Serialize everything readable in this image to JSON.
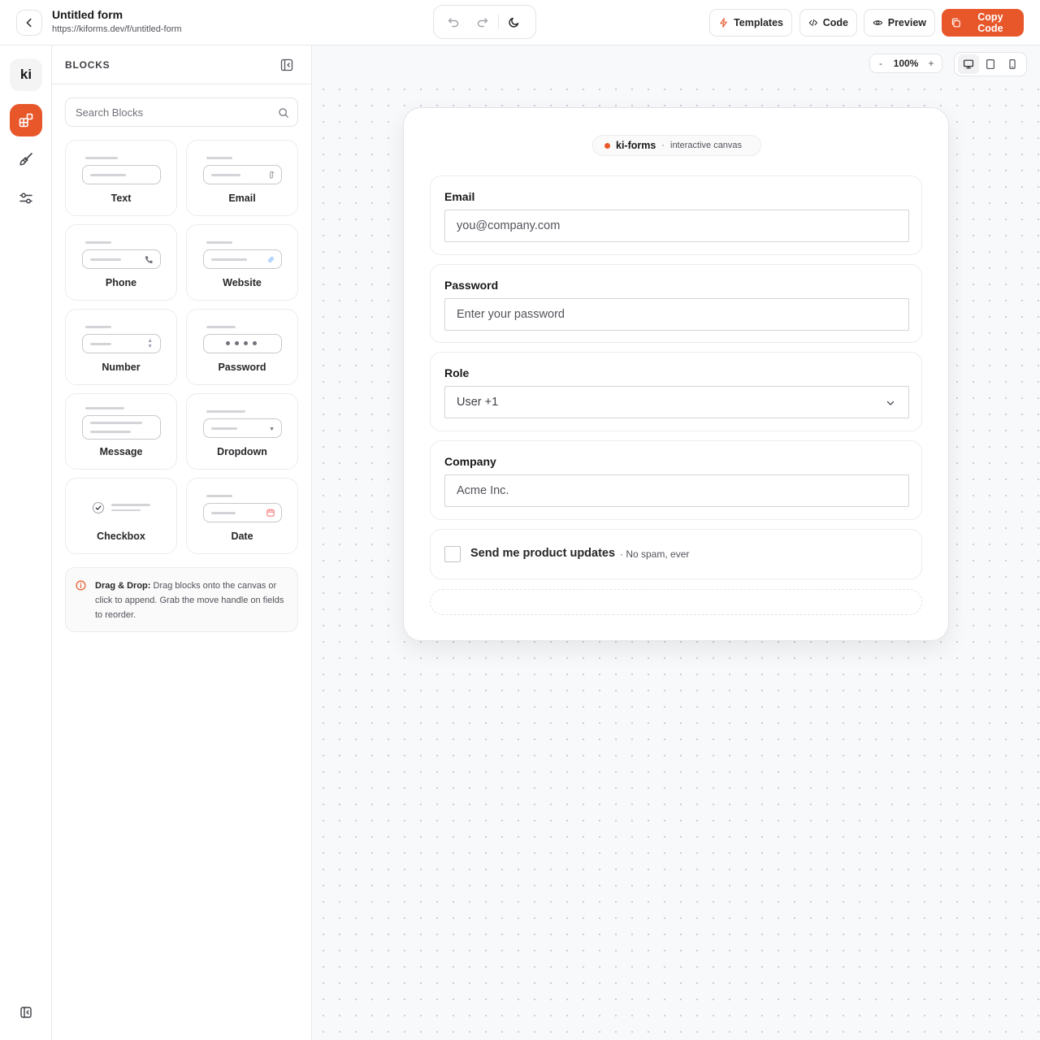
{
  "header": {
    "title": "Untitled form",
    "url": "https://kiforms.dev/f/untitled-form",
    "buttons": {
      "templates": "Templates",
      "code": "Code",
      "preview": "Preview",
      "copy_code": "Copy Code"
    }
  },
  "rail": {
    "logo": "ki",
    "items": [
      "blocks-icon",
      "brush-icon",
      "sliders-icon",
      "panel-collapse-icon"
    ]
  },
  "sidebar": {
    "title": "BLOCKS",
    "search_placeholder": "Search Blocks",
    "blocks": [
      "Text",
      "Email",
      "Phone",
      "Website",
      "Number",
      "Password",
      "Message",
      "Dropdown",
      "Checkbox",
      "Date"
    ],
    "info": {
      "title": "Drag & Drop:",
      "text": " Drag blocks onto the canvas or click to append. Grab the move handle on fields to reorder."
    }
  },
  "canvas": {
    "zoom": {
      "minus": "-",
      "value": "100%",
      "plus": "+"
    },
    "devices": [
      "desktop",
      "tablet",
      "mobile"
    ],
    "active_device": "desktop"
  },
  "form": {
    "badge": {
      "name": "ki-forms",
      "separator": "·",
      "subtitle": "interactive canvas"
    },
    "fields": {
      "email": {
        "label": "Email",
        "placeholder": "you@company.com"
      },
      "password": {
        "label": "Password",
        "placeholder": "Enter your password"
      },
      "role": {
        "label": "Role",
        "value": "User +1"
      },
      "company": {
        "label": "Company",
        "placeholder": "Acme Inc."
      }
    },
    "checkbox": {
      "label": "Send me product updates",
      "hint": "· No spam, ever",
      "checked": false
    }
  },
  "colors": {
    "accent": "#e8572a",
    "border": "#e4e4e7",
    "canvas_bg": "#f8f9fb"
  }
}
